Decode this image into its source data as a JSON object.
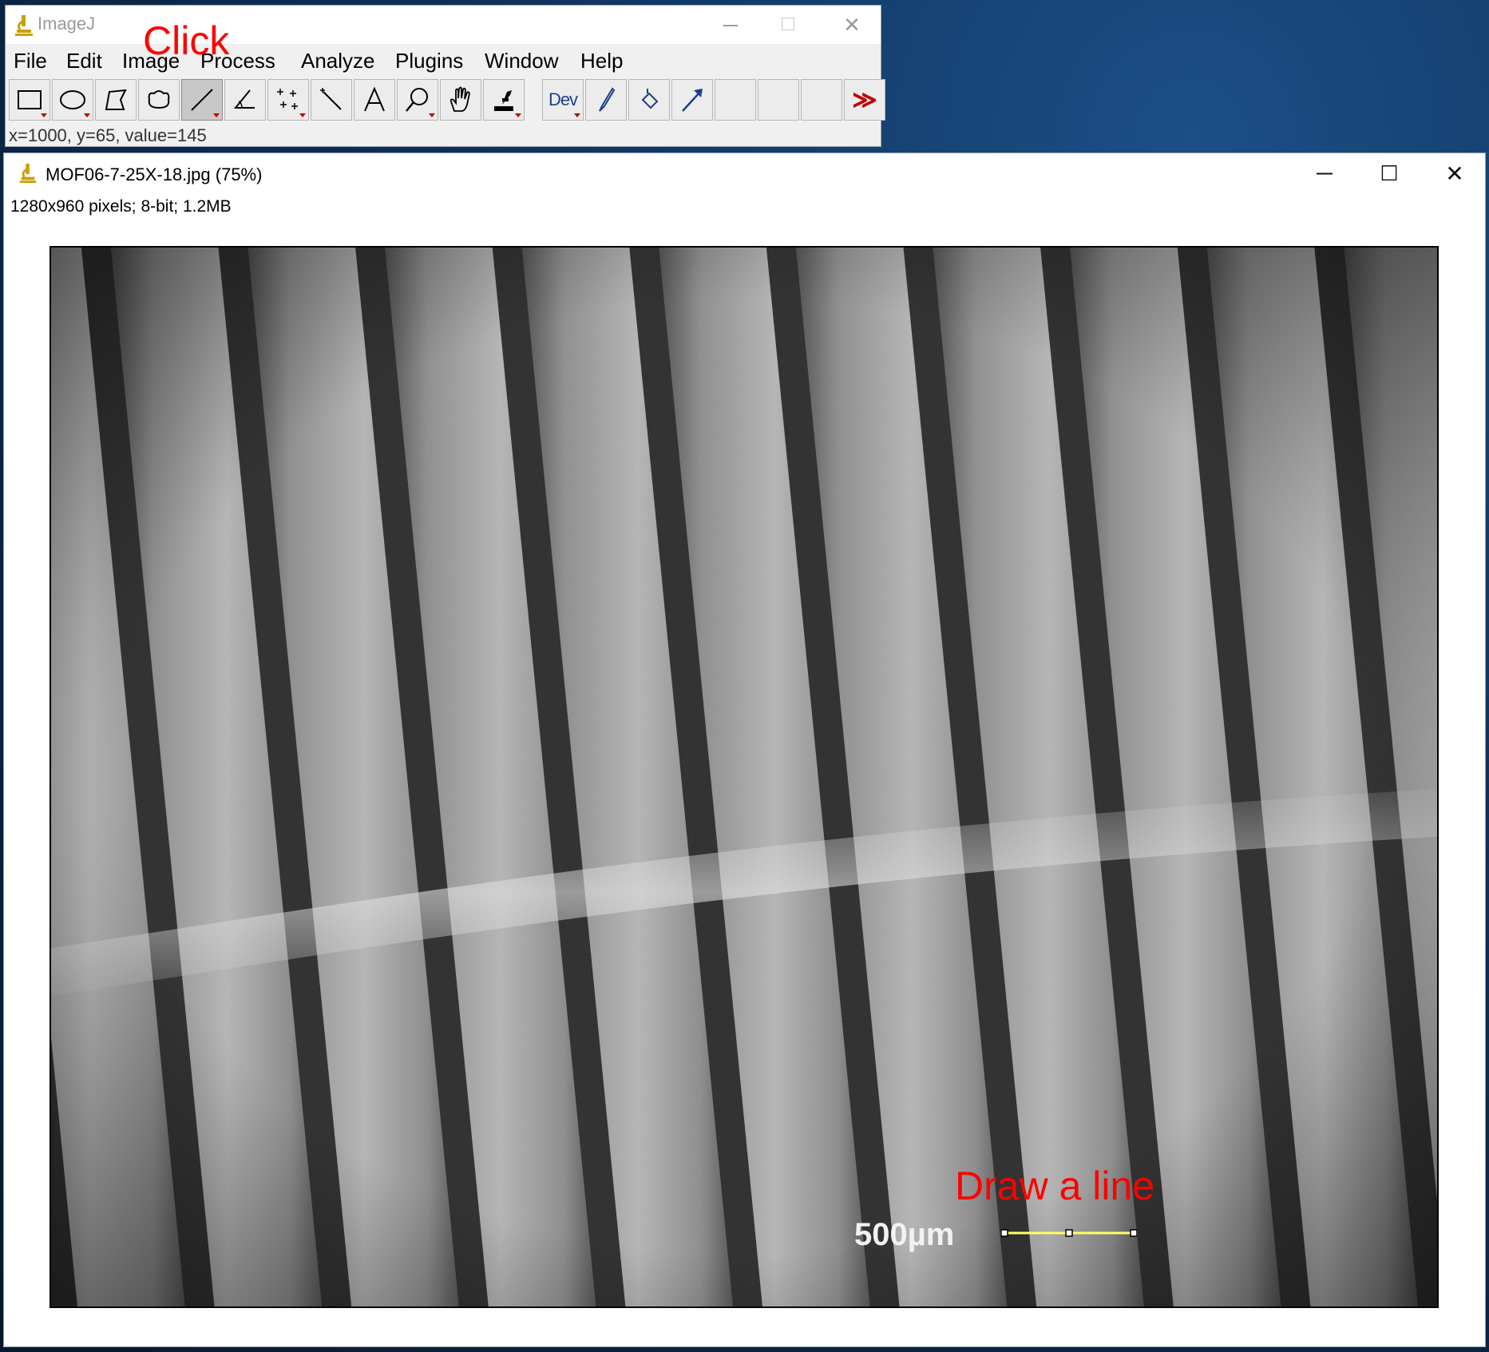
{
  "imagej": {
    "title": "ImageJ",
    "menu": [
      "File",
      "Edit",
      "Image",
      "Process",
      "Analyze",
      "Plugins",
      "Window",
      "Help"
    ],
    "tools": [
      {
        "name": "rectangle-tool-icon"
      },
      {
        "name": "oval-tool-icon"
      },
      {
        "name": "polygon-tool-icon"
      },
      {
        "name": "freehand-tool-icon"
      },
      {
        "name": "straight-line-tool-icon",
        "selected": true
      },
      {
        "name": "angle-tool-icon"
      },
      {
        "name": "multi-point-tool-icon"
      },
      {
        "name": "wand-tool-icon"
      },
      {
        "name": "text-tool-icon"
      },
      {
        "name": "magnifier-tool-icon"
      },
      {
        "name": "hand-tool-icon"
      },
      {
        "name": "color-picker-tool-icon"
      },
      {
        "name": "dev-menu-icon",
        "label": "Dev"
      },
      {
        "name": "brush-tool-icon"
      },
      {
        "name": "flood-fill-tool-icon"
      },
      {
        "name": "arrow-tool-icon"
      },
      {
        "name": "empty-slot-1"
      },
      {
        "name": "empty-slot-2"
      },
      {
        "name": "empty-slot-3"
      },
      {
        "name": "more-tools-icon",
        "label": "≫"
      }
    ],
    "status": "x=1000, y=65, value=145"
  },
  "image_window": {
    "title": "MOF06-7-25X-18.jpg (75%)",
    "info": "1280x960 pixels; 8-bit; 1.2MB",
    "scale_bar_label": "500µm"
  },
  "annotations": {
    "click": "Click",
    "draw": "Draw a line"
  },
  "colors": {
    "annotation": "#ff0000",
    "roi_line": "#ffff66"
  }
}
